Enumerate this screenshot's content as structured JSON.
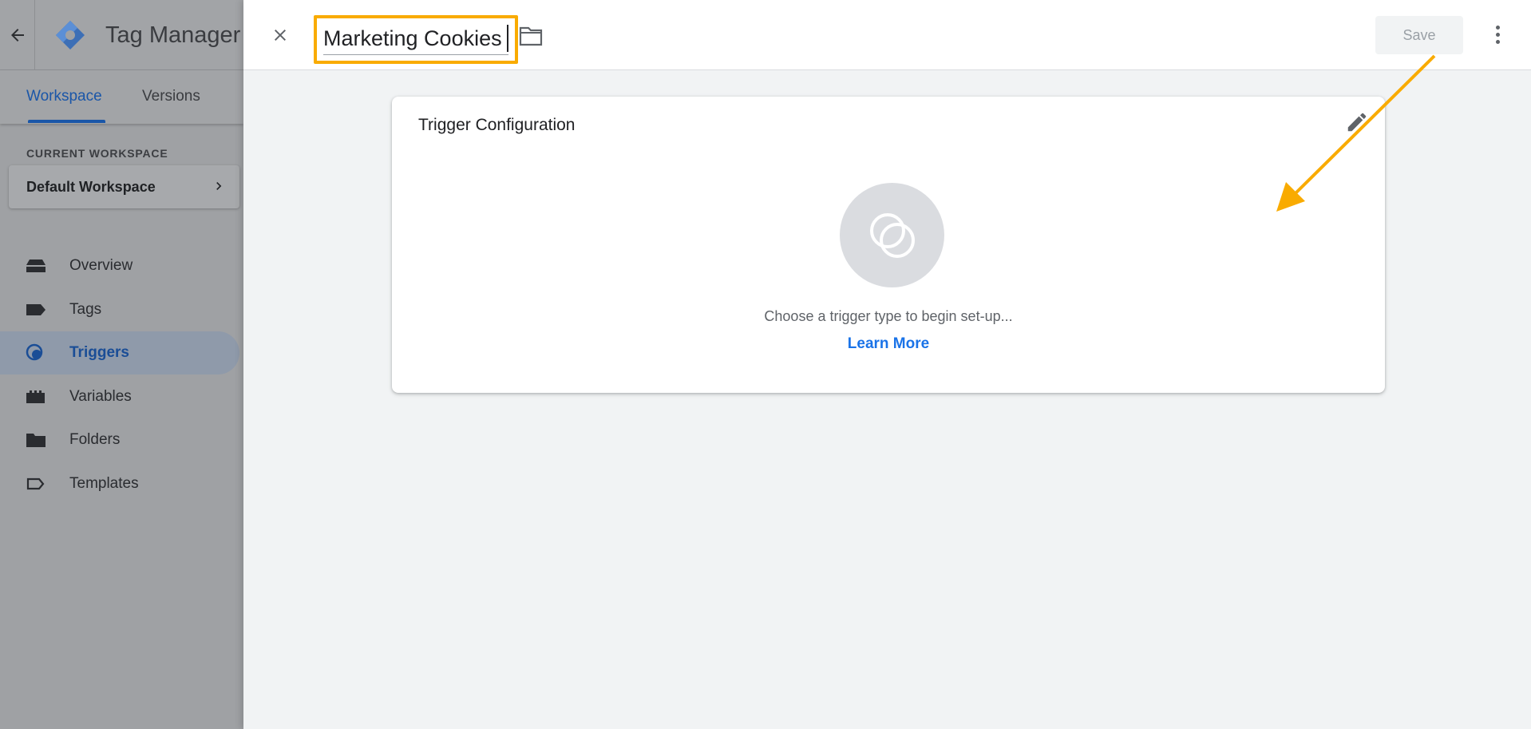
{
  "shell": {
    "app_title": "Tag Manager",
    "tabs": [
      {
        "label": "Workspace",
        "active": true
      },
      {
        "label": "Versions",
        "active": false
      }
    ],
    "workspace_section_label": "CURRENT WORKSPACE",
    "workspace_name": "Default Workspace",
    "nav": [
      {
        "label": "Overview",
        "icon": "overview-icon",
        "active": false
      },
      {
        "label": "Tags",
        "icon": "tag-icon",
        "active": false
      },
      {
        "label": "Triggers",
        "icon": "trigger-icon",
        "active": true
      },
      {
        "label": "Variables",
        "icon": "variables-icon",
        "active": false
      },
      {
        "label": "Folders",
        "icon": "folder-icon",
        "active": false
      },
      {
        "label": "Templates",
        "icon": "template-icon",
        "active": false
      }
    ]
  },
  "editor": {
    "name_value": "Marketing Cookies",
    "save_label": "Save",
    "card_title": "Trigger Configuration",
    "hint": "Choose a trigger type to begin set-up...",
    "learn_more": "Learn More"
  },
  "colors": {
    "accent_blue": "#1a73e8",
    "highlight_orange": "#f9ab00",
    "gtm_blue": "#4285f4"
  }
}
